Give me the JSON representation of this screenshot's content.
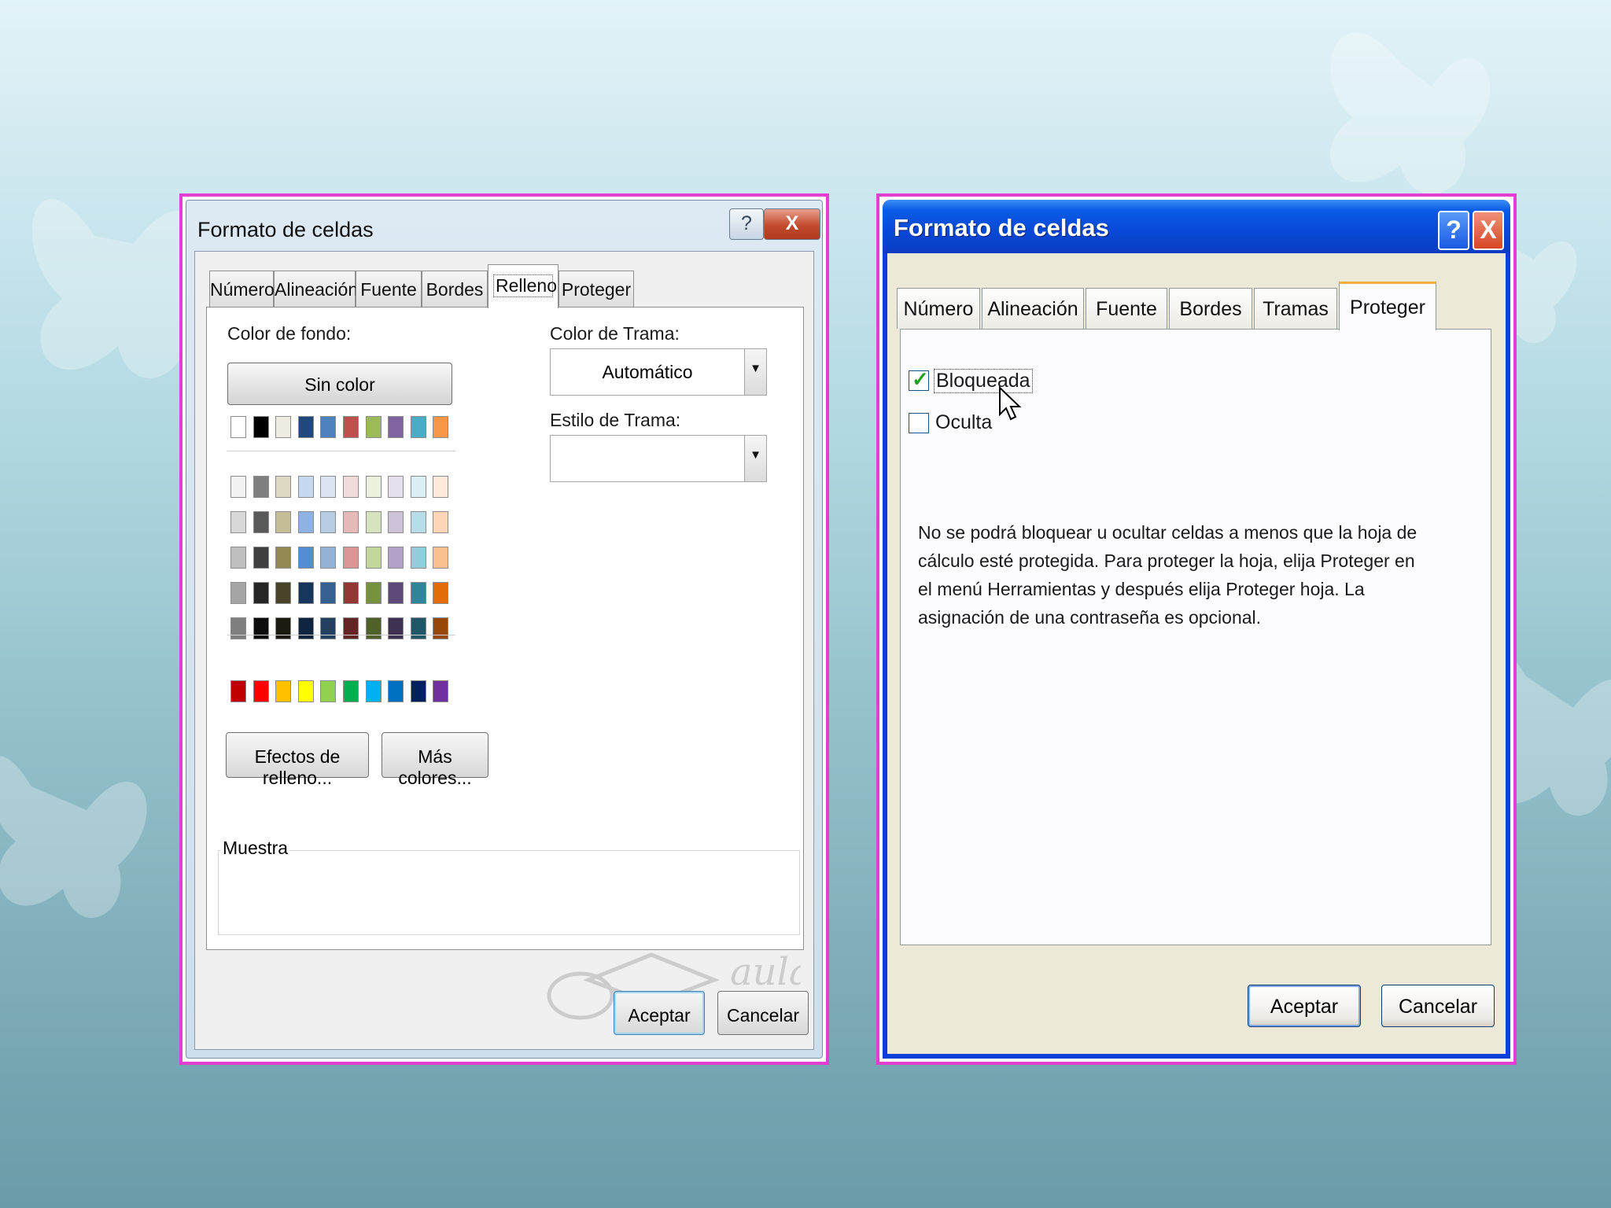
{
  "left_dialog": {
    "title": "Formato de celdas",
    "help_button": "?",
    "close_button": "X",
    "tabs": [
      {
        "label": "Número"
      },
      {
        "label": "Alineación"
      },
      {
        "label": "Fuente"
      },
      {
        "label": "Bordes"
      },
      {
        "label": "Relleno",
        "active": true
      },
      {
        "label": "Proteger"
      }
    ],
    "background_color_label": "Color de fondo:",
    "no_color_button": "Sin color",
    "pattern_color_label": "Color de Trama:",
    "pattern_color_value": "Automático",
    "pattern_style_label": "Estilo de Trama:",
    "pattern_style_value": "",
    "fill_effects_button": "Efectos de relleno...",
    "more_colors_button": "Más colores...",
    "sample_label": "Muestra",
    "ok_button": "Aceptar",
    "cancel_button": "Cancelar",
    "palette": {
      "theme_row": [
        "#ffffff",
        "#000000",
        "#eeece1",
        "#1f497d",
        "#4f81bd",
        "#c0504d",
        "#9bbb59",
        "#8064a2",
        "#4bacc6",
        "#f79646"
      ],
      "tints": [
        [
          "#f2f2f2",
          "#7f7f7f",
          "#ddd9c3",
          "#c6d9f0",
          "#dbe5f1",
          "#f2dcdb",
          "#ebf1dd",
          "#e5e0ec",
          "#dbeef3",
          "#fdeada"
        ],
        [
          "#d8d8d8",
          "#595959",
          "#c4bd97",
          "#8db3e2",
          "#b8cce4",
          "#e5b9b7",
          "#d7e3bc",
          "#ccc1d9",
          "#b7dde8",
          "#fbd5b5"
        ],
        [
          "#bfbfbf",
          "#3f3f3f",
          "#938953",
          "#548dd4",
          "#95b3d7",
          "#d99694",
          "#c3d69b",
          "#b2a2c7",
          "#92cddc",
          "#fac08f"
        ],
        [
          "#a5a5a5",
          "#262626",
          "#494429",
          "#17365d",
          "#366092",
          "#953734",
          "#76923c",
          "#5f497a",
          "#31859b",
          "#e36c09"
        ],
        [
          "#7f7f7f",
          "#0c0c0c",
          "#1d1b10",
          "#0f243e",
          "#244061",
          "#632423",
          "#4f6128",
          "#3f3151",
          "#205867",
          "#974806"
        ]
      ],
      "standard_row": [
        "#c00000",
        "#ff0000",
        "#ffc000",
        "#ffff00",
        "#92d050",
        "#00b050",
        "#00b0f0",
        "#0070c0",
        "#002060",
        "#7030a0"
      ]
    }
  },
  "right_dialog": {
    "title": "Formato de celdas",
    "help_button": "?",
    "close_button": "X",
    "tabs": [
      {
        "label": "Número"
      },
      {
        "label": "Alineación"
      },
      {
        "label": "Fuente"
      },
      {
        "label": "Bordes"
      },
      {
        "label": "Tramas"
      },
      {
        "label": "Proteger",
        "active": true
      }
    ],
    "locked_label": "Bloqueada",
    "locked_checked": true,
    "hidden_label": "Oculta",
    "hidden_checked": false,
    "note": "No se podrá bloquear u ocultar celdas a menos que la hoja de cálculo esté protegida. Para proteger la hoja, elija Proteger en el menú Herramientas y después elija Proteger hoja. La asignación de una contraseña es opcional.",
    "ok_button": "Aceptar",
    "cancel_button": "Cancelar"
  },
  "colors": {
    "frame_accent": "#e23fd0",
    "xp_titlebar": "#0a4fd8",
    "checkbox_tick": "#21a121"
  },
  "icons": [
    "butterfly-decoration",
    "help-icon",
    "close-icon",
    "dropdown-arrow-icon",
    "checkmark-icon",
    "mouse-cursor-icon",
    "watermark-logo"
  ]
}
